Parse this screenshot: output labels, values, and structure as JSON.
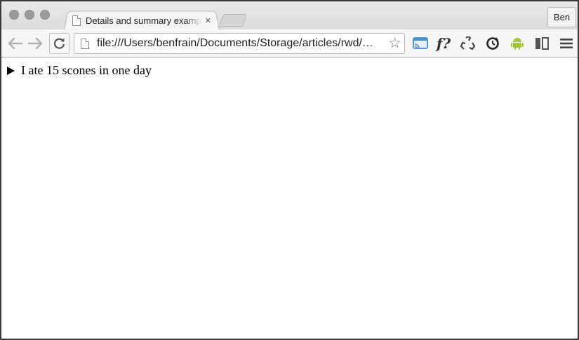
{
  "browser": {
    "tab": {
      "title": "Details and summary example",
      "close": "×"
    },
    "profile_label": "Ben",
    "address_bar": {
      "url": "file:///Users/benfrain/Documents/Storage/articles/rwd/…"
    },
    "extensions": [
      "cast-icon",
      "whatfont-icon",
      "recycle-icon",
      "sync-icon",
      "android-icon",
      "panels-icon",
      "menu-icon"
    ],
    "colors": {
      "android": "#9cc83a",
      "cast": "#4b8fd6"
    }
  },
  "page": {
    "details": {
      "summary": "I ate 15 scones in one day",
      "open": false
    }
  }
}
